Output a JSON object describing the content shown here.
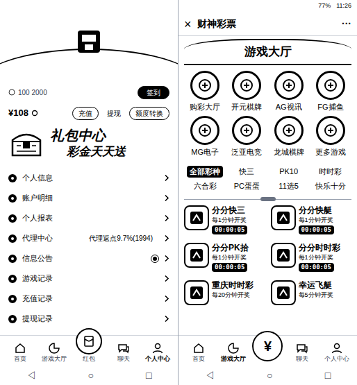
{
  "left": {
    "profile": {
      "id": "100 2000",
      "sign_button": "签到"
    },
    "balance": {
      "amount": "¥108",
      "actions": [
        "充值",
        "提现",
        "额度转换"
      ]
    },
    "banner": {
      "title": "礼包中心",
      "subtitle": "彩金天天送"
    },
    "menu": [
      {
        "label": "个人信息",
        "badge": false
      },
      {
        "label": "账户明细",
        "badge": false
      },
      {
        "label": "个人报表",
        "badge": false
      },
      {
        "label": "代理中心",
        "value": "代理返点9.7%(1994)",
        "badge": false
      },
      {
        "label": "信息公告",
        "badge": true
      },
      {
        "label": "游戏记录",
        "badge": false
      },
      {
        "label": "充值记录",
        "badge": false
      },
      {
        "label": "提现记录",
        "badge": false
      }
    ],
    "nav": [
      {
        "label": "首页",
        "selected": false,
        "kind": "tab"
      },
      {
        "label": "游戏大厅",
        "selected": false,
        "kind": "tab"
      },
      {
        "label": "红包",
        "selected": false,
        "kind": "center-labeled"
      },
      {
        "label": "聊天",
        "selected": false,
        "kind": "tab"
      },
      {
        "label": "个人中心",
        "selected": true,
        "kind": "tab"
      }
    ]
  },
  "right": {
    "status_bar": {
      "battery": "77%",
      "time": "11:26"
    },
    "header": {
      "close": "×",
      "title": "财神彩票",
      "more": "···"
    },
    "section_title": "游戏大厅",
    "games": [
      "购彩大厅",
      "开元棋牌",
      "AG视讯",
      "FG捕鱼",
      "MG电子",
      "泛亚电竞",
      "龙城棋牌",
      "更多游戏"
    ],
    "tabs": [
      {
        "label": "全部彩种",
        "selected": true
      },
      {
        "label": "快三",
        "selected": false
      },
      {
        "label": "PK10",
        "selected": false
      },
      {
        "label": "时时彩",
        "selected": false
      },
      {
        "label": "六合彩",
        "selected": false
      },
      {
        "label": "PC蛋蛋",
        "selected": false
      },
      {
        "label": "11选5",
        "selected": false
      },
      {
        "label": "快乐十分",
        "selected": false
      }
    ],
    "lotteries": [
      {
        "name": "分分快三",
        "schedule": "每1分钟开奖",
        "countdown": "00:00:05"
      },
      {
        "name": "分分快艇",
        "schedule": "每1分钟开奖",
        "countdown": "00:00:05"
      },
      {
        "name": "分分PK拾",
        "schedule": "每1分钟开奖",
        "countdown": "00:00:05"
      },
      {
        "name": "分分时时彩",
        "schedule": "每1分钟开奖",
        "countdown": "00:00:05"
      },
      {
        "name": "重庆时时彩",
        "schedule": "每20分钟开奖"
      },
      {
        "name": "幸运飞艇",
        "schedule": "每5分钟开奖"
      }
    ],
    "nav": [
      {
        "label": "首页",
        "selected": false,
        "kind": "tab"
      },
      {
        "label": "游戏大厅",
        "selected": true,
        "kind": "tab"
      },
      {
        "label": "¥",
        "selected": false,
        "kind": "center-symbol"
      },
      {
        "label": "聊天",
        "selected": false,
        "kind": "tab"
      },
      {
        "label": "个人中心",
        "selected": false,
        "kind": "tab"
      }
    ]
  },
  "system_nav": [
    "◁",
    "○",
    "□"
  ]
}
